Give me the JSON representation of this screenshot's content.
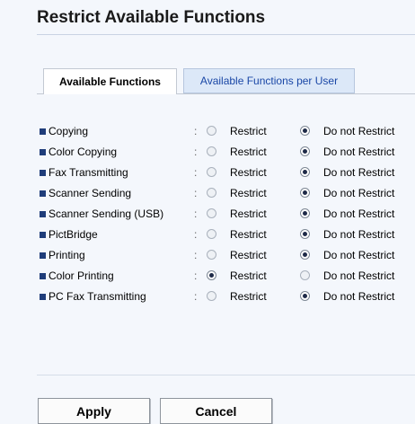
{
  "page": {
    "title": "Restrict Available Functions"
  },
  "tabs": [
    {
      "label": "Available Functions",
      "active": true
    },
    {
      "label": "Available Functions per User",
      "active": false
    }
  ],
  "options": {
    "restrict": "Restrict",
    "do_not_restrict": "Do not Restrict",
    "separator": ":"
  },
  "functions": [
    {
      "label": "Copying",
      "selected": "do_not_restrict"
    },
    {
      "label": "Color Copying",
      "selected": "do_not_restrict"
    },
    {
      "label": "Fax Transmitting",
      "selected": "do_not_restrict"
    },
    {
      "label": "Scanner Sending",
      "selected": "do_not_restrict"
    },
    {
      "label": "Scanner Sending (USB)",
      "selected": "do_not_restrict"
    },
    {
      "label": "PictBridge",
      "selected": "do_not_restrict"
    },
    {
      "label": "Printing",
      "selected": "do_not_restrict"
    },
    {
      "label": "Color Printing",
      "selected": "restrict"
    },
    {
      "label": "PC Fax Transmitting",
      "selected": "do_not_restrict"
    }
  ],
  "buttons": {
    "apply": "Apply",
    "cancel": "Cancel"
  },
  "colors": {
    "bullet": "#1f3d7a",
    "tab_inactive_text": "#1a47a6",
    "background": "#f4f7fc"
  }
}
